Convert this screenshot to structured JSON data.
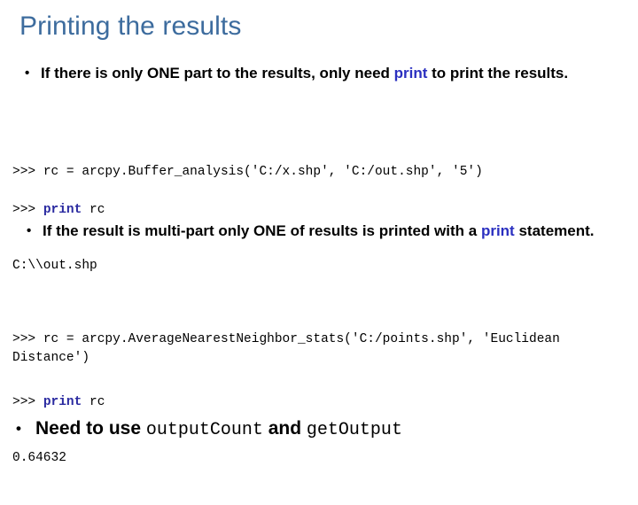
{
  "slide": {
    "title": "Printing the results",
    "title_color": "#3d6c9e",
    "background_color": "#ffffff",
    "bullet_marker": "•"
  },
  "bullets": [
    {
      "id": "bullet-one",
      "segments": [
        {
          "text": "If there is only ONE part to the results, only need ",
          "style": "plain"
        },
        {
          "text": "print",
          "style": "keyword"
        },
        {
          "text": " to print the results.",
          "style": "plain"
        }
      ],
      "plain_text": "If there is only ONE part to the results, only need print to print the results."
    },
    {
      "id": "bullet-two",
      "segments": [
        {
          "text": "If the result is multi-part only ONE of results is printed with a ",
          "style": "plain"
        },
        {
          "text": "print",
          "style": "keyword"
        },
        {
          "text": " statement.",
          "style": "plain"
        }
      ],
      "plain_text": "If the result is multi-part only ONE of results is printed with a print statement."
    },
    {
      "id": "bullet-three",
      "segments": [
        {
          "text": "Need to use ",
          "style": "plain"
        },
        {
          "text": "outputCount",
          "style": "mono"
        },
        {
          "text": " and ",
          "style": "plain"
        },
        {
          "text": "getOutput",
          "style": "mono"
        }
      ],
      "plain_text": "Need to use outputCount and getOutput"
    }
  ],
  "code_blocks": [
    {
      "id": "code-one",
      "prompt": ">>> ",
      "text": "rc = arcpy.Buffer_analysis('C:/x.shp', 'C:/out.shp', '5')",
      "full": ">>> rc = arcpy.Buffer_analysis('C:/x.shp', 'C:/out.shp', '5')"
    },
    {
      "id": "code-two",
      "prompt": ">>> ",
      "keyword": "print",
      "after_keyword": " rc",
      "output": "C:\\\\out.shp",
      "full": ">>> print rc\nC:\\\\out.shp"
    },
    {
      "id": "code-three",
      "prompt": ">>> ",
      "text": "rc = arcpy.AverageNearestNeighbor_stats('C:/points.shp', 'Euclidean Distance')",
      "full": ">>> rc = arcpy.AverageNearestNeighbor_stats('C:/points.shp', 'Euclidean Distance')"
    },
    {
      "id": "code-four",
      "prompt": ">>> ",
      "keyword": "print",
      "after_keyword": " rc",
      "output": "0.64632",
      "full": ">>> print rc\n0.64632"
    }
  ],
  "colors": {
    "title_blue": "#3d6c9e",
    "keyword_blue": "#2b30c0",
    "code_keyword_blue": "#2a2aa0",
    "body_black": "#000000",
    "background": "#ffffff"
  }
}
